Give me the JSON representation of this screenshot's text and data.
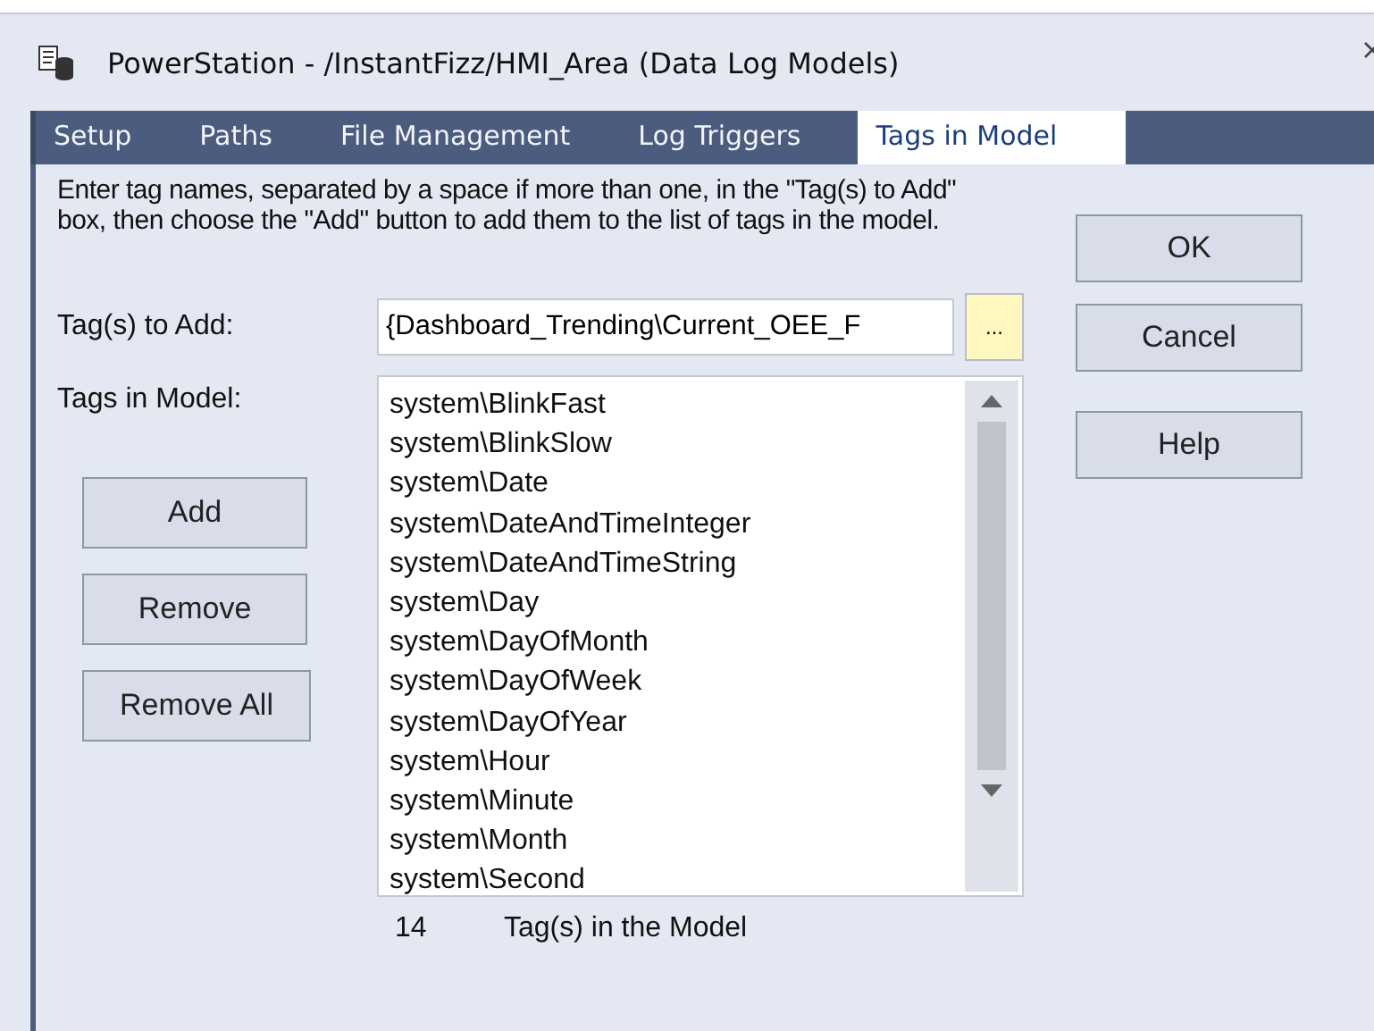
{
  "window": {
    "title": "PowerStation - /InstantFizz/HMI_Area (Data Log Models)"
  },
  "tabs": [
    {
      "label": "Setup",
      "selected": false
    },
    {
      "label": "Paths",
      "selected": false
    },
    {
      "label": "File Management",
      "selected": false
    },
    {
      "label": "Log Triggers",
      "selected": false
    },
    {
      "label": "Tags in Model",
      "selected": true
    }
  ],
  "instructions": "Enter tag names, separated by a space if more than one, in the \"Tag(s) to Add\" box, then choose the \"Add\"  button to add them to the list of tags in the model.",
  "tag_to_add": {
    "label": "Tag(s) to Add:",
    "value": "{Dashboard_Trending\\Current_OEE_F",
    "browse": "..."
  },
  "tags_in_model": {
    "label": "Tags in Model:",
    "items": [
      "system\\BlinkFast",
      "system\\BlinkSlow",
      "system\\Date",
      "system\\DateAndTimeInteger",
      "system\\DateAndTimeString",
      "system\\Day",
      "system\\DayOfMonth",
      "system\\DayOfWeek",
      "system\\DayOfYear",
      "system\\Hour",
      "system\\Minute",
      "system\\Month",
      "system\\Second"
    ]
  },
  "list_buttons": [
    "Add",
    "Remove",
    "Remove All"
  ],
  "dialog_buttons": [
    "OK",
    "Cancel",
    "Help"
  ],
  "count": {
    "value": "14",
    "label": "Tag(s) in the Model"
  }
}
